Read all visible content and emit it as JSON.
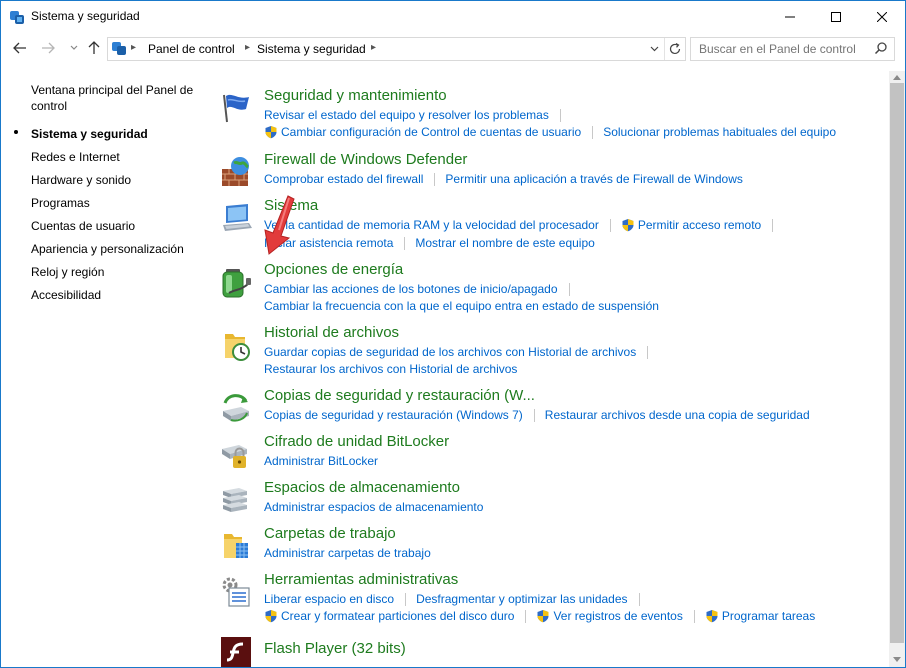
{
  "window": {
    "title": "Sistema y seguridad"
  },
  "address": {
    "crumbs": [
      "Panel de control",
      "Sistema y seguridad"
    ],
    "search_placeholder": "Buscar en el Panel de control"
  },
  "sidebar": {
    "home": "Ventana principal del Panel de control",
    "items": [
      "Sistema y seguridad",
      "Redes e Internet",
      "Hardware y sonido",
      "Programas",
      "Cuentas de usuario",
      "Apariencia y personalización",
      "Reloj y región",
      "Accesibilidad"
    ],
    "current_index": 0
  },
  "categories": [
    {
      "title": "Seguridad y mantenimiento",
      "icon": "flag-icon",
      "rows": [
        [
          {
            "text": "Revisar el estado del equipo y resolver los problemas"
          }
        ],
        [
          {
            "text": "Cambiar configuración de Control de cuentas de usuario",
            "shield": true
          },
          {
            "text": "Solucionar problemas habituales del equipo"
          }
        ]
      ]
    },
    {
      "title": "Firewall de Windows Defender",
      "icon": "firewall-icon",
      "rows": [
        [
          {
            "text": "Comprobar estado del firewall"
          },
          {
            "text": "Permitir una aplicación a través de Firewall de Windows"
          }
        ]
      ]
    },
    {
      "title": "Sistema",
      "icon": "computer-icon",
      "rows": [
        [
          {
            "text": "Ver la cantidad de memoria RAM y la velocidad del procesador"
          },
          {
            "text": "Permitir acceso remoto",
            "shield": true
          }
        ],
        [
          {
            "text": "Iniciar asistencia remota"
          },
          {
            "text": "Mostrar el nombre de este equipo"
          }
        ]
      ]
    },
    {
      "title": "Opciones de energía",
      "icon": "battery-icon",
      "rows": [
        [
          {
            "text": "Cambiar las acciones de los botones de inicio/apagado"
          }
        ],
        [
          {
            "text": "Cambiar la frecuencia con la que el equipo entra en estado de suspensión"
          }
        ]
      ]
    },
    {
      "title": "Historial de archivos",
      "icon": "file-history-icon",
      "rows": [
        [
          {
            "text": "Guardar copias de seguridad de los archivos con Historial de archivos"
          }
        ],
        [
          {
            "text": "Restaurar los archivos con Historial de archivos"
          }
        ]
      ]
    },
    {
      "title": "Copias de seguridad y restauración (W...",
      "icon": "backup-icon",
      "rows": [
        [
          {
            "text": "Copias de seguridad y restauración (Windows 7)"
          },
          {
            "text": "Restaurar archivos desde una copia de seguridad"
          }
        ]
      ]
    },
    {
      "title": "Cifrado de unidad BitLocker",
      "icon": "bitlocker-icon",
      "rows": [
        [
          {
            "text": "Administrar BitLocker"
          }
        ]
      ]
    },
    {
      "title": "Espacios de almacenamiento",
      "icon": "storage-icon",
      "rows": [
        [
          {
            "text": "Administrar espacios de almacenamiento"
          }
        ]
      ]
    },
    {
      "title": "Carpetas de trabajo",
      "icon": "work-folders-icon",
      "rows": [
        [
          {
            "text": "Administrar carpetas de trabajo"
          }
        ]
      ]
    },
    {
      "title": "Herramientas administrativas",
      "icon": "admin-tools-icon",
      "rows": [
        [
          {
            "text": "Liberar espacio en disco"
          },
          {
            "text": "Desfragmentar y optimizar las unidades"
          }
        ],
        [
          {
            "text": "Crear y formatear particiones del disco duro",
            "shield": true
          },
          {
            "text": "Ver registros de eventos",
            "shield": true
          },
          {
            "text": "Programar tareas",
            "shield": true
          }
        ]
      ]
    },
    {
      "title": "Flash Player (32 bits)",
      "icon": "flash-player-icon",
      "rows": []
    }
  ],
  "colors": {
    "link": "#0066cc",
    "category_title": "#1e7b1e",
    "window_border": "#1979ca",
    "annotation_arrow": "#e23b3b"
  }
}
